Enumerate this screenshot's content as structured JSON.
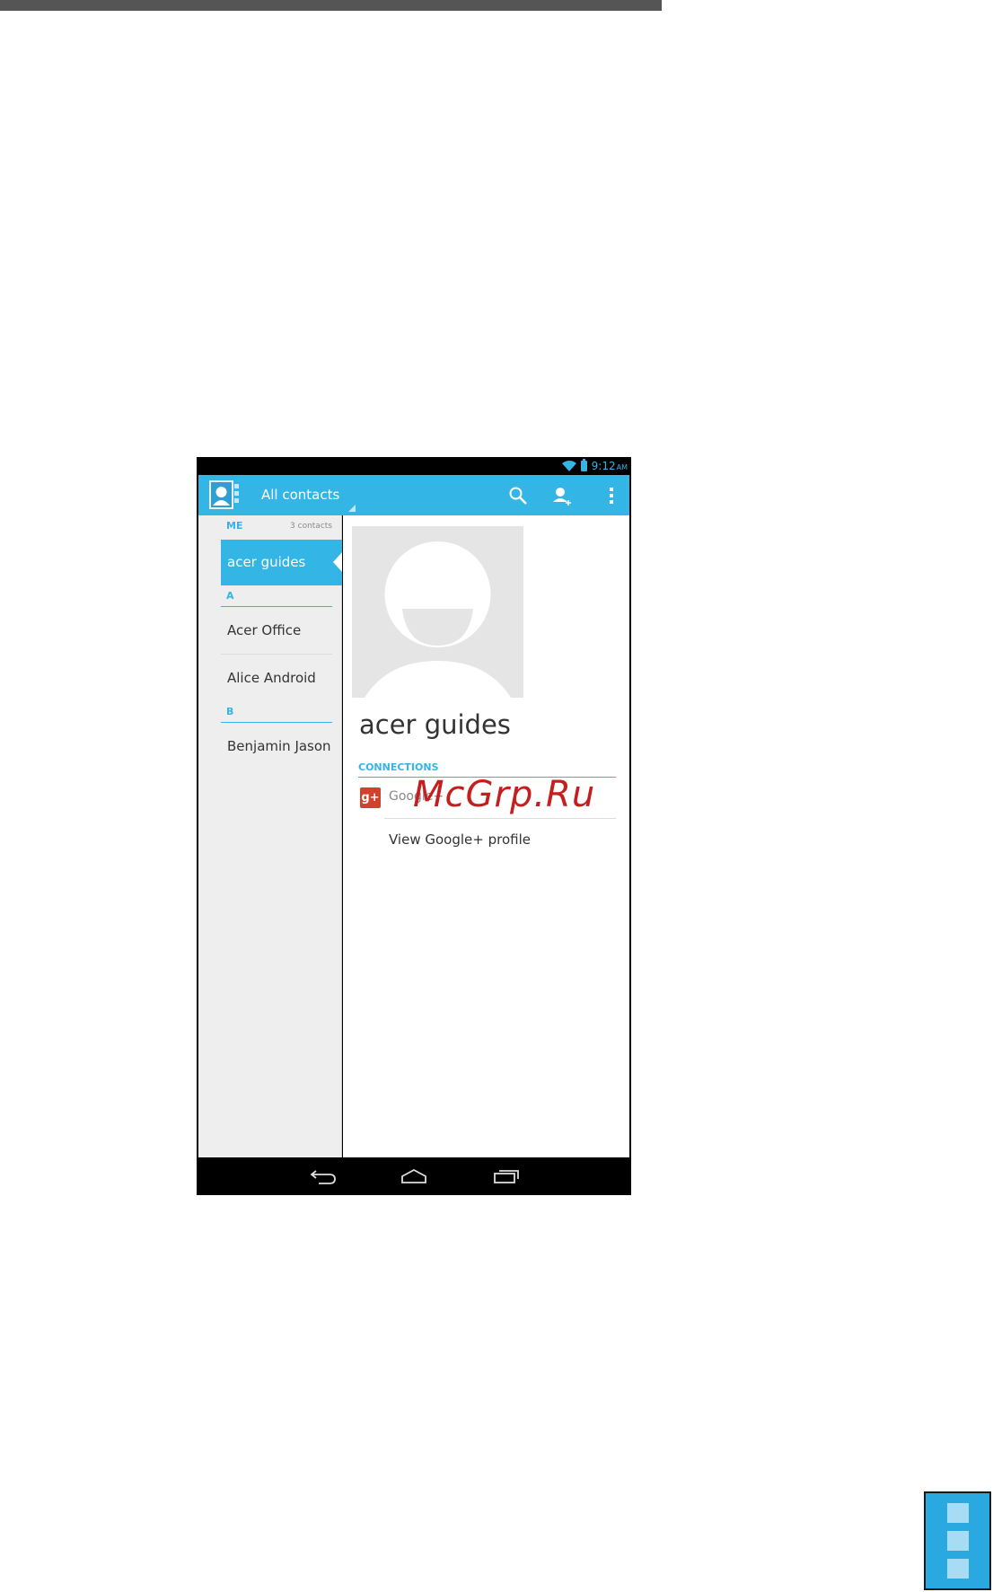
{
  "statusbar": {
    "time": "9:12",
    "ampm": "AM"
  },
  "actionbar": {
    "title": "All contacts",
    "icons": [
      "contacts-app-icon",
      "search-icon",
      "add-contact-icon",
      "overflow-menu-icon"
    ]
  },
  "list": {
    "me_header": "ME",
    "count": "3 contacts",
    "selected": "acer guides",
    "sections": [
      {
        "letter": "A",
        "contacts": [
          "Acer Office",
          "Alice Android"
        ]
      },
      {
        "letter": "B",
        "contacts": [
          "Benjamin Jason"
        ]
      }
    ]
  },
  "detail": {
    "name": "acer guides",
    "connections_header": "CONNECTIONS",
    "connection_label": "Google+",
    "view_profile": "View Google+ profile"
  },
  "watermark": "McGrp.Ru",
  "colors": {
    "accent": "#33b5e5",
    "pane_bg": "#eeeeee",
    "gplus": "#d0422d",
    "watermark": "#c41e1e"
  }
}
